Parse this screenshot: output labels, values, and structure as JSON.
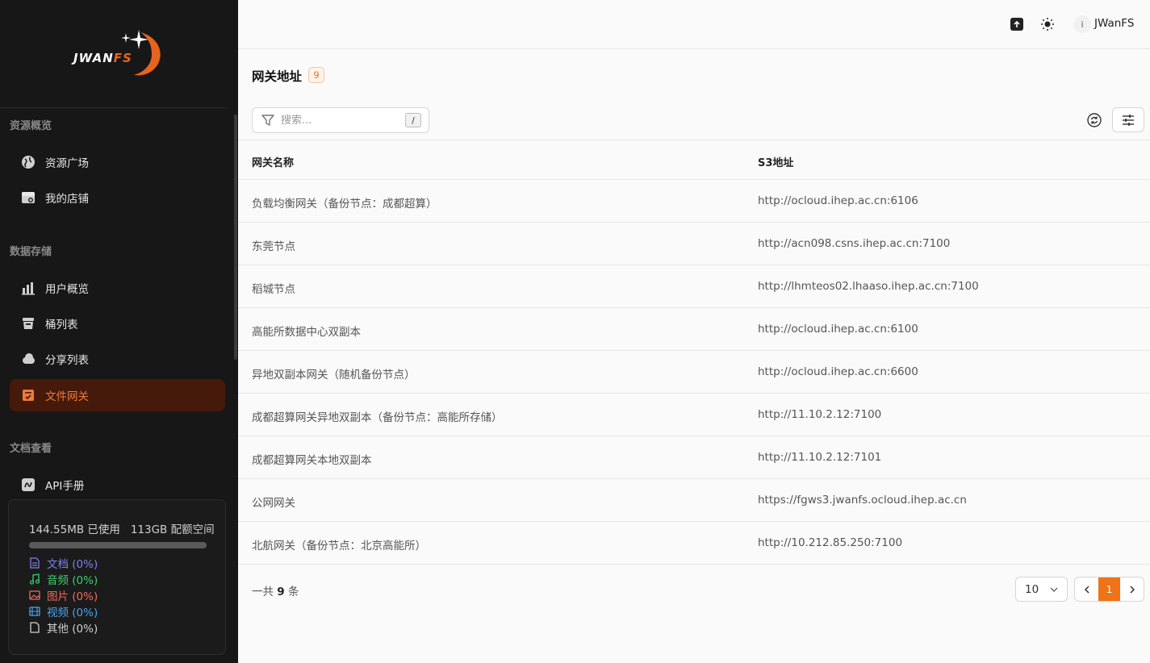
{
  "app": {
    "logo_text_a": "JWAN",
    "logo_text_b": "FS"
  },
  "sidebar": {
    "sections": [
      {
        "title": "资源概览"
      },
      {
        "title": "数据存储"
      },
      {
        "title": "文档查看"
      }
    ],
    "items": [
      {
        "label": "资源广场",
        "icon": "globe-icon"
      },
      {
        "label": "我的店铺",
        "icon": "store-icon"
      },
      {
        "label": "用户概览",
        "icon": "bar-chart-icon"
      },
      {
        "label": "桶列表",
        "icon": "bucket-icon"
      },
      {
        "label": "分享列表",
        "icon": "cloud-share-icon"
      },
      {
        "label": "文件网关",
        "icon": "gateway-icon",
        "active": true
      },
      {
        "label": "API手册",
        "icon": "api-book-icon"
      }
    ],
    "usage": {
      "used": "144.55MB 已使用",
      "quota": "113GB 配额空间",
      "legend": [
        {
          "label": "文档 (0%)",
          "color": "#7b83e8",
          "icon": "document-icon"
        },
        {
          "label": "音频 (0%)",
          "color": "#3ccf6e",
          "icon": "music-icon"
        },
        {
          "label": "图片 (0%)",
          "color": "#f26b5b",
          "icon": "image-icon"
        },
        {
          "label": "视频 (0%)",
          "color": "#4da3f0",
          "icon": "video-icon"
        },
        {
          "label": "其他 (0%)",
          "color": "#cfcfcf",
          "icon": "file-icon"
        }
      ]
    }
  },
  "topbar": {
    "avatar_letter": "i",
    "username": "JWanFS"
  },
  "page": {
    "title": "网关地址",
    "count": "9",
    "search_placeholder": "搜索...",
    "shortcut": "/"
  },
  "table": {
    "columns": [
      "网关名称",
      "S3地址"
    ],
    "rows": [
      [
        "负载均衡网关（备份节点：成都超算）",
        "http://ocloud.ihep.ac.cn:6106"
      ],
      [
        "东莞节点",
        "http://acn098.csns.ihep.ac.cn:7100"
      ],
      [
        "稻城节点",
        "http://lhmteos02.lhaaso.ihep.ac.cn:7100"
      ],
      [
        "高能所数据中心双副本",
        "http://ocloud.ihep.ac.cn:6100"
      ],
      [
        "异地双副本网关（随机备份节点）",
        "http://ocloud.ihep.ac.cn:6600"
      ],
      [
        "成都超算网关异地双副本（备份节点：高能所存储）",
        "http://11.10.2.12:7100"
      ],
      [
        "成都超算网关本地双副本",
        "http://11.10.2.12:7101"
      ],
      [
        "公网网关",
        "https://fgws3.jwanfs.ocloud.ihep.ac.cn"
      ],
      [
        "北航网关（备份节点：北京高能所）",
        "http://10.212.85.250:7100"
      ]
    ]
  },
  "footer": {
    "total_prefix": "一共",
    "total_count": "9",
    "total_suffix": "条",
    "page_size": "10",
    "current_page": "1"
  },
  "colors": {
    "accent": "#f07318",
    "sidebar_bg": "#171717",
    "active_bg": "#461a0b"
  }
}
